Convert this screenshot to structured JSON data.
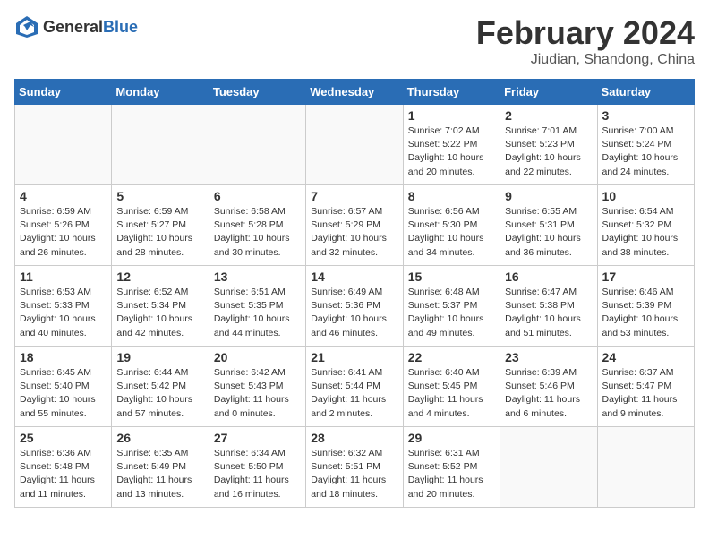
{
  "header": {
    "logo_general": "General",
    "logo_blue": "Blue",
    "month_title": "February 2024",
    "subtitle": "Jiudian, Shandong, China"
  },
  "days_of_week": [
    "Sunday",
    "Monday",
    "Tuesday",
    "Wednesday",
    "Thursday",
    "Friday",
    "Saturday"
  ],
  "weeks": [
    [
      {
        "day": "",
        "info": ""
      },
      {
        "day": "",
        "info": ""
      },
      {
        "day": "",
        "info": ""
      },
      {
        "day": "",
        "info": ""
      },
      {
        "day": "1",
        "info": "Sunrise: 7:02 AM\nSunset: 5:22 PM\nDaylight: 10 hours\nand 20 minutes."
      },
      {
        "day": "2",
        "info": "Sunrise: 7:01 AM\nSunset: 5:23 PM\nDaylight: 10 hours\nand 22 minutes."
      },
      {
        "day": "3",
        "info": "Sunrise: 7:00 AM\nSunset: 5:24 PM\nDaylight: 10 hours\nand 24 minutes."
      }
    ],
    [
      {
        "day": "4",
        "info": "Sunrise: 6:59 AM\nSunset: 5:26 PM\nDaylight: 10 hours\nand 26 minutes."
      },
      {
        "day": "5",
        "info": "Sunrise: 6:59 AM\nSunset: 5:27 PM\nDaylight: 10 hours\nand 28 minutes."
      },
      {
        "day": "6",
        "info": "Sunrise: 6:58 AM\nSunset: 5:28 PM\nDaylight: 10 hours\nand 30 minutes."
      },
      {
        "day": "7",
        "info": "Sunrise: 6:57 AM\nSunset: 5:29 PM\nDaylight: 10 hours\nand 32 minutes."
      },
      {
        "day": "8",
        "info": "Sunrise: 6:56 AM\nSunset: 5:30 PM\nDaylight: 10 hours\nand 34 minutes."
      },
      {
        "day": "9",
        "info": "Sunrise: 6:55 AM\nSunset: 5:31 PM\nDaylight: 10 hours\nand 36 minutes."
      },
      {
        "day": "10",
        "info": "Sunrise: 6:54 AM\nSunset: 5:32 PM\nDaylight: 10 hours\nand 38 minutes."
      }
    ],
    [
      {
        "day": "11",
        "info": "Sunrise: 6:53 AM\nSunset: 5:33 PM\nDaylight: 10 hours\nand 40 minutes."
      },
      {
        "day": "12",
        "info": "Sunrise: 6:52 AM\nSunset: 5:34 PM\nDaylight: 10 hours\nand 42 minutes."
      },
      {
        "day": "13",
        "info": "Sunrise: 6:51 AM\nSunset: 5:35 PM\nDaylight: 10 hours\nand 44 minutes."
      },
      {
        "day": "14",
        "info": "Sunrise: 6:49 AM\nSunset: 5:36 PM\nDaylight: 10 hours\nand 46 minutes."
      },
      {
        "day": "15",
        "info": "Sunrise: 6:48 AM\nSunset: 5:37 PM\nDaylight: 10 hours\nand 49 minutes."
      },
      {
        "day": "16",
        "info": "Sunrise: 6:47 AM\nSunset: 5:38 PM\nDaylight: 10 hours\nand 51 minutes."
      },
      {
        "day": "17",
        "info": "Sunrise: 6:46 AM\nSunset: 5:39 PM\nDaylight: 10 hours\nand 53 minutes."
      }
    ],
    [
      {
        "day": "18",
        "info": "Sunrise: 6:45 AM\nSunset: 5:40 PM\nDaylight: 10 hours\nand 55 minutes."
      },
      {
        "day": "19",
        "info": "Sunrise: 6:44 AM\nSunset: 5:42 PM\nDaylight: 10 hours\nand 57 minutes."
      },
      {
        "day": "20",
        "info": "Sunrise: 6:42 AM\nSunset: 5:43 PM\nDaylight: 11 hours\nand 0 minutes."
      },
      {
        "day": "21",
        "info": "Sunrise: 6:41 AM\nSunset: 5:44 PM\nDaylight: 11 hours\nand 2 minutes."
      },
      {
        "day": "22",
        "info": "Sunrise: 6:40 AM\nSunset: 5:45 PM\nDaylight: 11 hours\nand 4 minutes."
      },
      {
        "day": "23",
        "info": "Sunrise: 6:39 AM\nSunset: 5:46 PM\nDaylight: 11 hours\nand 6 minutes."
      },
      {
        "day": "24",
        "info": "Sunrise: 6:37 AM\nSunset: 5:47 PM\nDaylight: 11 hours\nand 9 minutes."
      }
    ],
    [
      {
        "day": "25",
        "info": "Sunrise: 6:36 AM\nSunset: 5:48 PM\nDaylight: 11 hours\nand 11 minutes."
      },
      {
        "day": "26",
        "info": "Sunrise: 6:35 AM\nSunset: 5:49 PM\nDaylight: 11 hours\nand 13 minutes."
      },
      {
        "day": "27",
        "info": "Sunrise: 6:34 AM\nSunset: 5:50 PM\nDaylight: 11 hours\nand 16 minutes."
      },
      {
        "day": "28",
        "info": "Sunrise: 6:32 AM\nSunset: 5:51 PM\nDaylight: 11 hours\nand 18 minutes."
      },
      {
        "day": "29",
        "info": "Sunrise: 6:31 AM\nSunset: 5:52 PM\nDaylight: 11 hours\nand 20 minutes."
      },
      {
        "day": "",
        "info": ""
      },
      {
        "day": "",
        "info": ""
      }
    ]
  ]
}
